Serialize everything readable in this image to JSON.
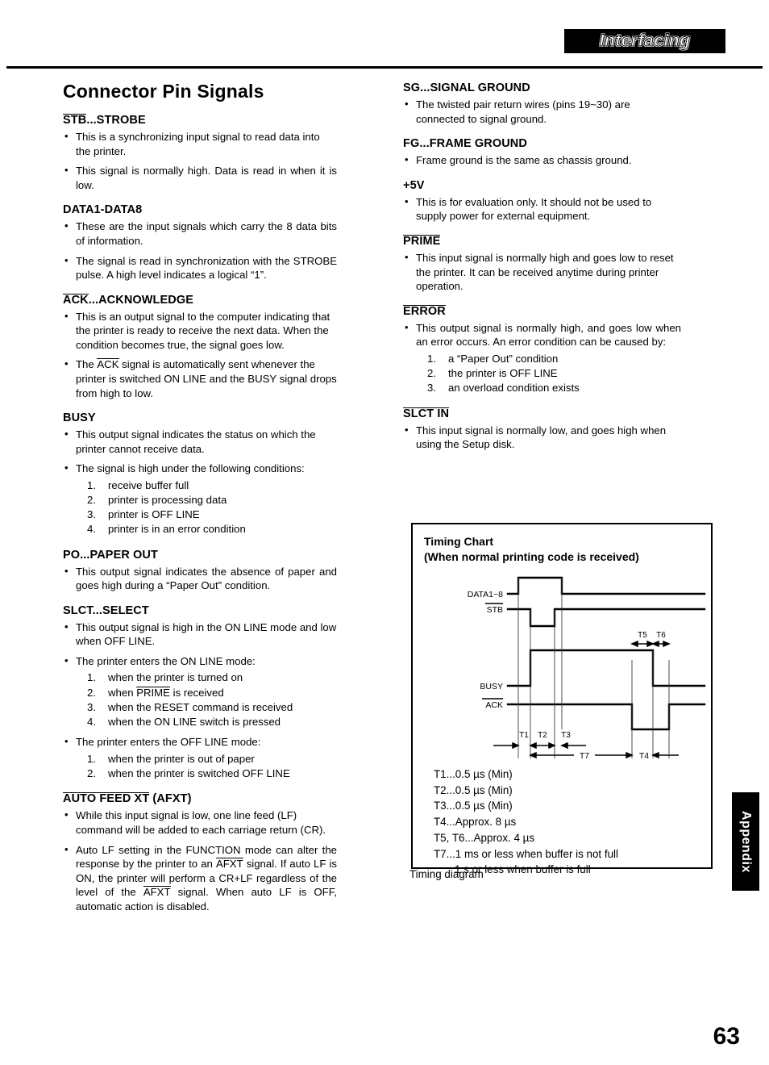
{
  "header": {
    "banner_title": "Interfacing"
  },
  "page_number": "63",
  "appendix_tab": "Appendix",
  "left_column": {
    "section_title": "Connector Pin Signals",
    "sections": [
      {
        "heading_overlined": "STB",
        "heading_rest": "...STROBE",
        "bullets": [
          "This is a synchronizing input signal to read data into the printer.",
          "This signal is normally high. Data is read in when it is low."
        ]
      },
      {
        "heading_overlined": "",
        "heading_rest": "DATA1-DATA8",
        "bullets": [
          "These are the input signals which carry the 8 data bits of information.",
          "The signal is read in synchronization with the STROBE pulse. A high level indicates a logical “1”."
        ]
      },
      {
        "heading_overlined": "ACK",
        "heading_rest": "...ACKNOWLEDGE",
        "bullets": [
          "This is an output signal to the computer indicating that the printer is ready to receive the next data. When the condition becomes true, the signal goes low."
        ],
        "bullet_ack_pre": "The ",
        "bullet_ack_ovl": "ACK",
        "bullet_ack_post": " signal is automatically sent whenever the printer is switched ON LINE and the BUSY signal drops from high to low."
      },
      {
        "heading_overlined": "",
        "heading_rest": "BUSY",
        "bullets": [
          "This output signal indicates the status on which the printer cannot receive data.",
          "The signal is high under the following conditions:"
        ],
        "numbered": [
          "receive buffer full",
          "printer is processing data",
          "printer is OFF LINE",
          "printer is in an error condition"
        ]
      },
      {
        "heading_overlined": "",
        "heading_rest": "PO...PAPER OUT",
        "bullets": [
          "This output signal indicates the absence of paper and goes high during a “Paper Out” condition."
        ]
      },
      {
        "heading_overlined": "",
        "heading_rest": "SLCT...SELECT",
        "bullets": [
          "This output signal is high in the ON LINE mode and low when OFF LINE.",
          "The printer enters the ON LINE mode:"
        ],
        "numbered_on": [
          "when the printer is turned on",
          "when PRIME is received",
          "when the RESET command is received",
          "when the ON LINE switch is pressed"
        ],
        "bullet_off": "The printer enters the OFF LINE mode:",
        "numbered_off": [
          "when the printer is out of paper",
          "when the printer is switched OFF LINE"
        ]
      },
      {
        "heading_overlined": "AUTO FEED XT",
        "heading_rest": " (AFXT)",
        "bullets": [
          "While this input signal is low, one line feed (LF) command will be added to each carriage return (CR)."
        ]
      }
    ],
    "afxt_paragraph": {
      "p1": "Auto LF setting in the FUNCTION mode can alter the response by the printer to an ",
      "ovl1": "AFXT",
      "p2": " signal. If auto LF is ON, the printer will perform a CR+LF regardless of the level of the ",
      "ovl2": "AFXT",
      "p3": " signal. When auto LF is OFF, automatic action is disabled."
    },
    "numbered_labels": [
      "1.",
      "2.",
      "3.",
      "4."
    ]
  },
  "right_column": {
    "sections": [
      {
        "heading_overlined": "",
        "heading_rest": "SG...SIGNAL GROUND",
        "bullets": [
          "The twisted pair return wires (pins 19~30) are connected to signal ground."
        ]
      },
      {
        "heading_overlined": "",
        "heading_rest": "FG...FRAME GROUND",
        "bullets": [
          "Frame ground is the same as chassis ground."
        ]
      },
      {
        "heading_overlined": "",
        "heading_rest": "+5V",
        "bullets": [
          "This is for evaluation only. It should not be used to supply power for external equipment."
        ]
      },
      {
        "heading_overlined": "PRIME",
        "heading_rest": "",
        "bullets": [
          "This input signal is normally high and goes low to reset the printer. It can be received anytime during printer operation."
        ]
      },
      {
        "heading_overlined": "ERROR",
        "heading_rest": "",
        "bullets": [
          "This output signal is normally high, and goes low when an error occurs. An error condition can be caused by:"
        ],
        "numbered": [
          "a “Paper Out” condition",
          "the printer is OFF LINE",
          "an overload condition exists"
        ]
      },
      {
        "heading_overlined": "SLCT IN",
        "heading_rest": "",
        "bullets": [
          "This input signal is normally low, and goes high when using the Setup disk."
        ]
      }
    ]
  },
  "chart_data": {
    "type": "line",
    "title": "Timing Chart",
    "subtitle": "(When normal printing code is received)",
    "caption": "Timing diagram",
    "signal_labels": [
      {
        "name": "DATA1~8",
        "overlined": false
      },
      {
        "name": "STB",
        "overlined": true
      },
      {
        "name": "BUSY",
        "overlined": false
      },
      {
        "name": "ACK",
        "overlined": true
      }
    ],
    "interval_labels": [
      "T1",
      "T2",
      "T3",
      "T5",
      "T6",
      "T7",
      "T4"
    ],
    "timings": [
      "T1...0.5 µs (Min)",
      "T2...0.5 µs (Min)",
      "T3...0.5 µs (Min)",
      "T4...Approx. 8 µs",
      "T5, T6...Approx. 4 µs",
      "T7...1 ms or less when buffer is not full"
    ],
    "timings_indent": "1 s or less when buffer is full",
    "waveforms": {
      "DATA1~8": {
        "idle": "low",
        "pulse": "high",
        "description": "data valid pulse between t=65 and t=150"
      },
      "STB": {
        "idle": "high",
        "pulse": "low",
        "description": "strobe goes low between t=95 and t=130"
      },
      "BUSY": {
        "idle": "low",
        "pulse": "high",
        "description": "busy rises at t=95, falls at t=290"
      },
      "ACK": {
        "idle": "high",
        "pulse": "low",
        "description": "ack goes low between t=265 and t=308"
      }
    }
  }
}
